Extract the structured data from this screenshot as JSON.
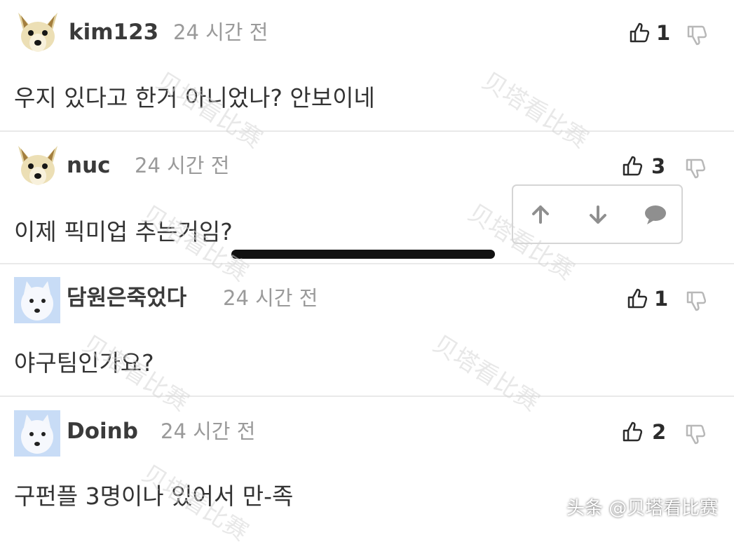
{
  "comments": [
    {
      "username": "kim123",
      "time": "24 시간 전",
      "likes": "1",
      "text": "우지 있다고 한거 아니었나? 안보이네",
      "avatar": "fox-avatar"
    },
    {
      "username": "nuc",
      "time": "24 시간 전",
      "likes": "3",
      "text": "이제 픽미업 추는거임?",
      "avatar": "fox-avatar"
    },
    {
      "username": "담원은죽었다",
      "time": "24 시간 전",
      "likes": "1",
      "text": "야구팀인가요?",
      "avatar": "white-dog-avatar"
    },
    {
      "username": "Doinb",
      "time": "24 시간 전",
      "likes": "2",
      "text": "구펀플 3명이나 있어서 만-족",
      "avatar": "white-dog-avatar"
    }
  ],
  "action_popup": {
    "icons": [
      "arrow-up-icon",
      "arrow-down-icon",
      "comment-bubble-icon"
    ]
  },
  "watermark": {
    "text": "贝塔看比赛",
    "footer": "头条 @贝塔看比赛"
  },
  "colors": {
    "text": "#333333",
    "muted": "#9a9a9a",
    "divider": "#e9e9e9",
    "icon": "#2b2b2b"
  }
}
